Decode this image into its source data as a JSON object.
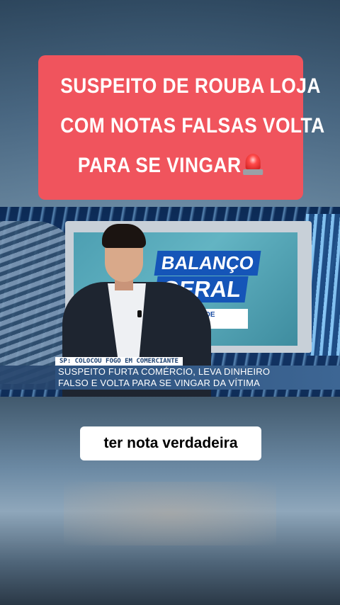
{
  "headline": {
    "lines": [
      "SUSPEITO DE ROUBA LOJA",
      "COM NOTAS FALSAS VOLTA",
      "PARA SE VINGAR"
    ],
    "emoji_icon": "police-siren-icon",
    "background_color": "#f0545d"
  },
  "video": {
    "studio_logo": {
      "line1": "BALANÇO",
      "line2": "GERAL",
      "subtitle": "EDIÇÃO DE SÁBADO"
    },
    "lower_third": {
      "tag": "SP: COLOCOU FOGO EM COMERCIANTE",
      "line1": "SUSPEITO FURTA COMÉRCIO, LEVA DINHEIRO",
      "line2": "FALSO E VOLTA PARA SE VINGAR DA VÍTIMA"
    }
  },
  "caption": {
    "text": "ter nota verdadeira"
  }
}
